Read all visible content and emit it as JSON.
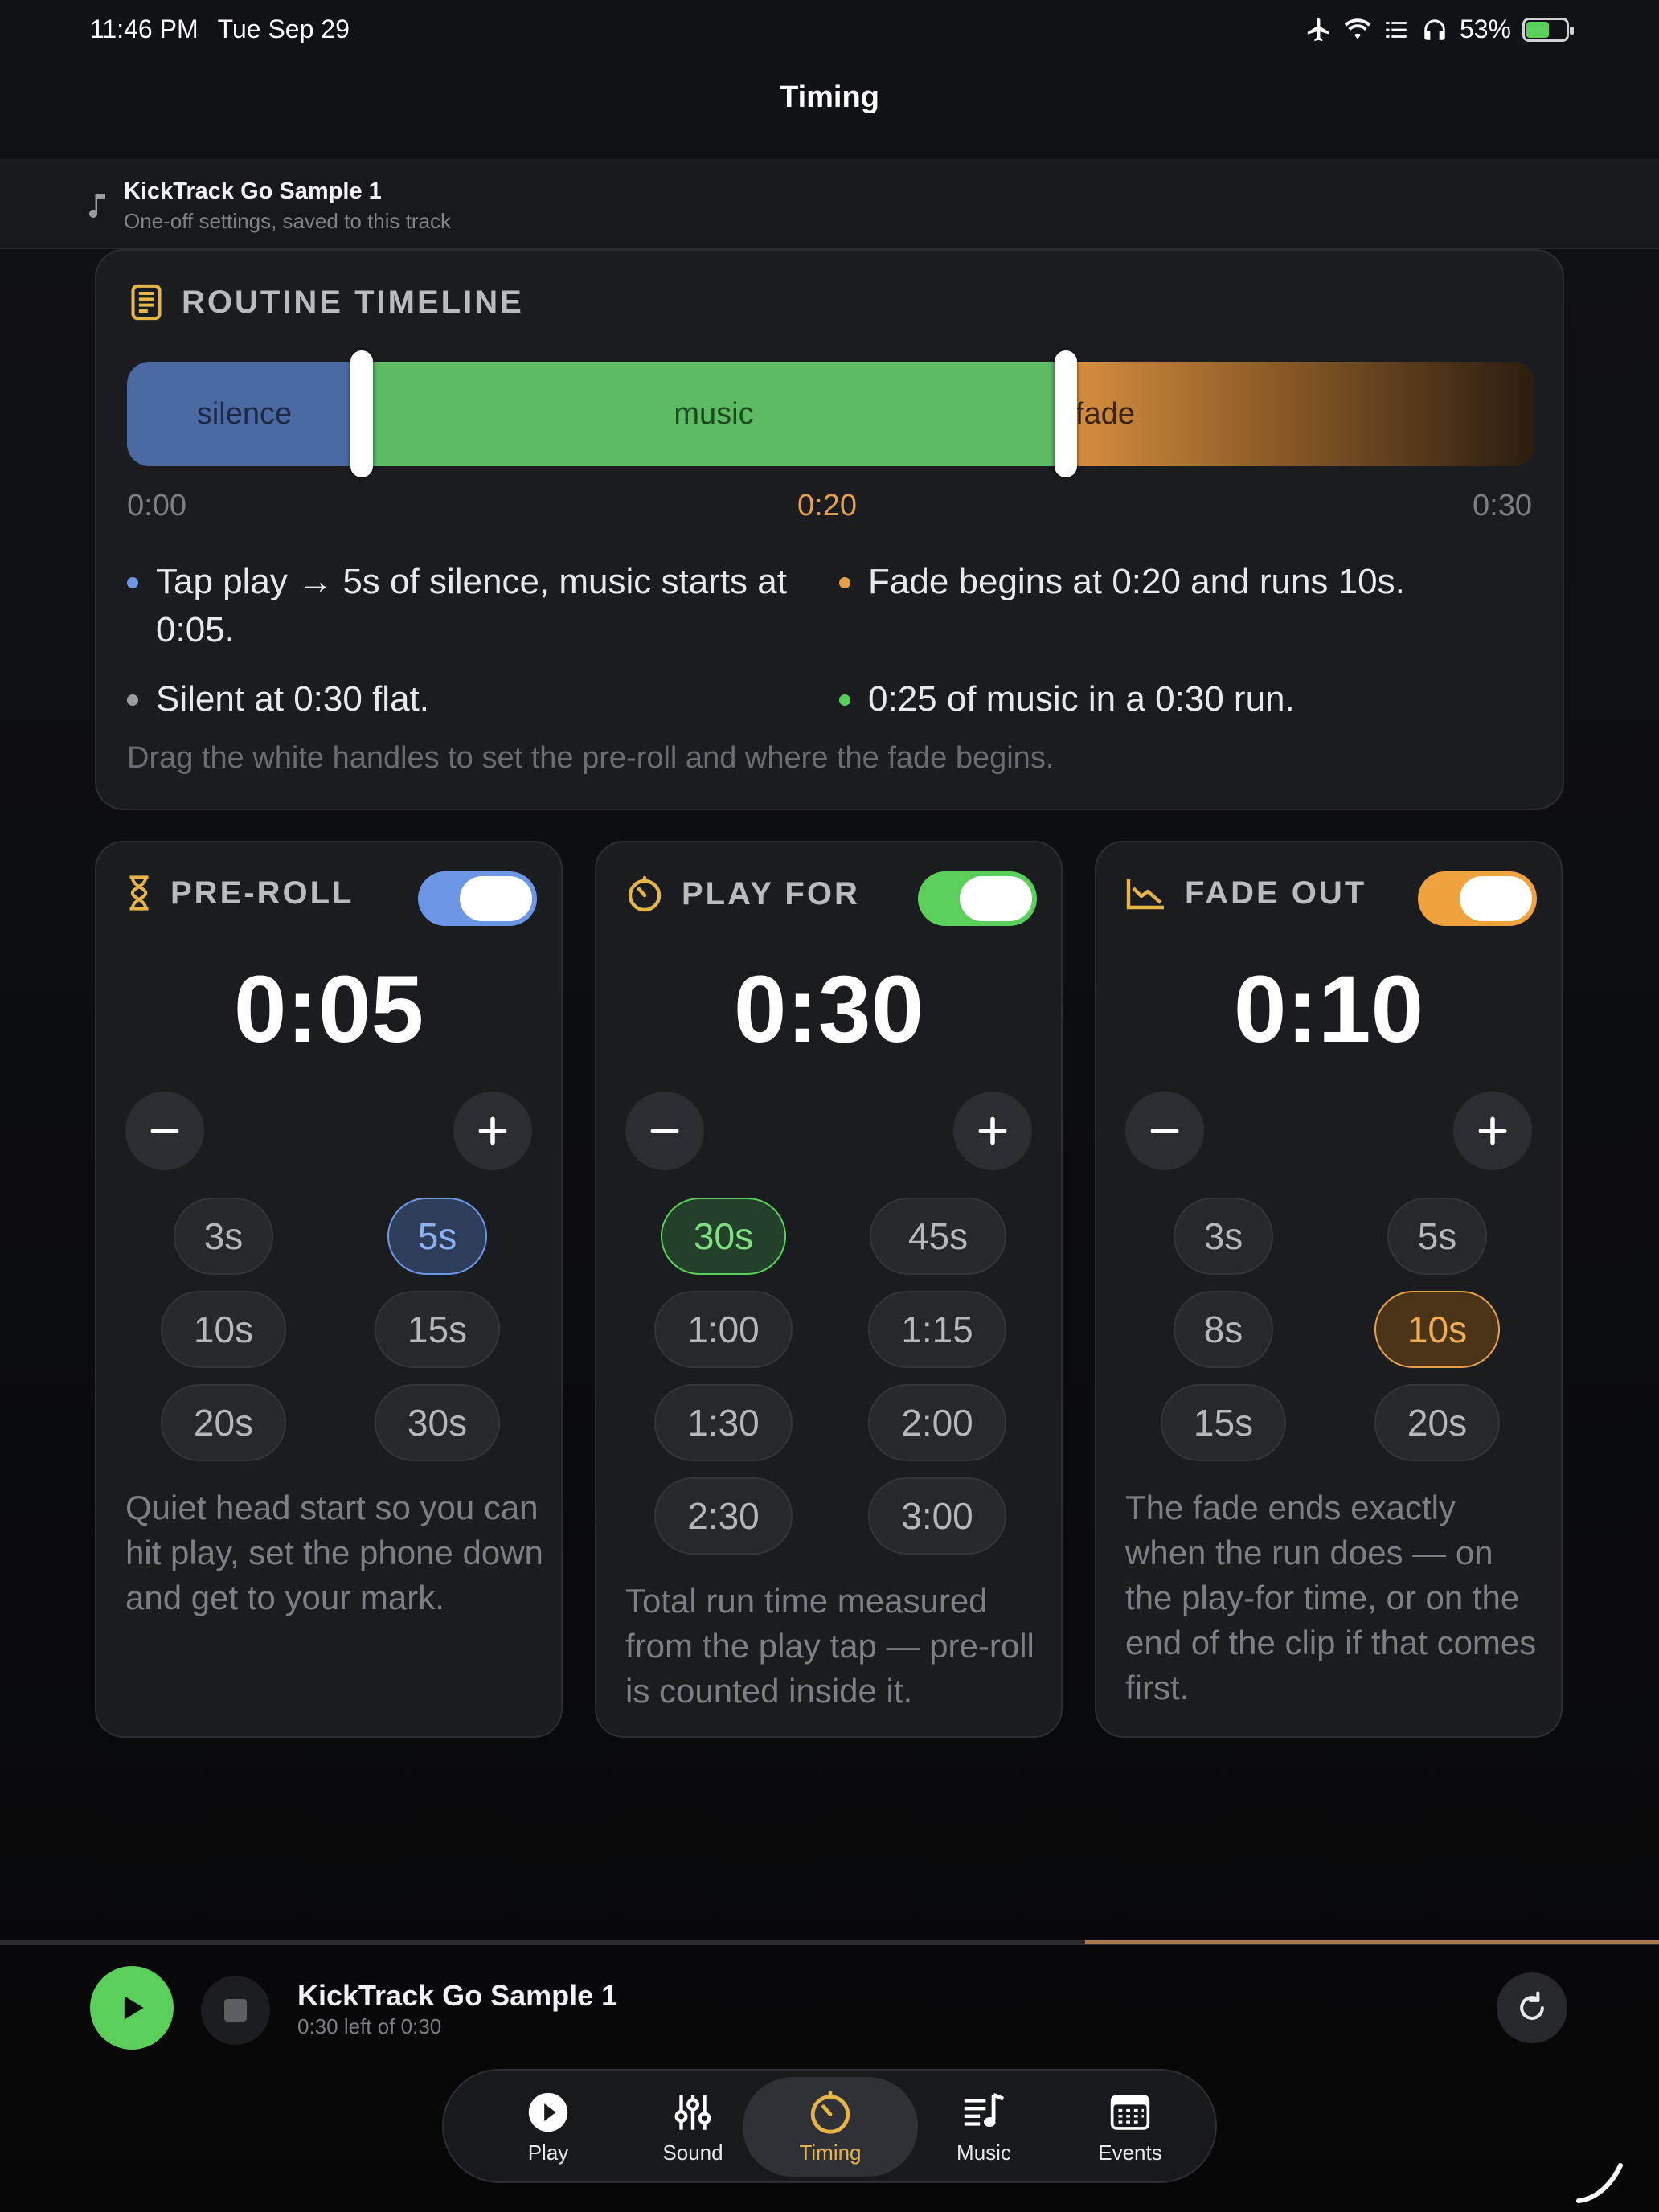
{
  "status_bar": {
    "time": "11:46 PM",
    "date": "Tue Sep 29",
    "battery": "53%"
  },
  "nav": {
    "title": "Timing"
  },
  "track": {
    "name": "KickTrack Go Sample 1",
    "subtitle": "One-off settings, saved to this track"
  },
  "timeline": {
    "title": "ROUTINE TIMELINE",
    "segments": {
      "silence": "silence",
      "music": "music",
      "fade": "fade"
    },
    "ticks": {
      "start": "0:00",
      "mid": "0:20",
      "end": "0:30"
    },
    "bullets": [
      "Tap play → 5s of silence, music starts at 0:05.",
      "Fade begins at 0:20 and runs 10s.",
      "Silent at 0:30 flat.",
      "0:25 of music in a 0:30 run."
    ],
    "hint": "Drag the white handles to set the pre-roll and where the fade begins."
  },
  "preroll": {
    "title": "PRE-ROLL",
    "value": "0:05",
    "enabled": true,
    "options": [
      "3s",
      "5s",
      "10s",
      "15s",
      "20s",
      "30s"
    ],
    "selected": "5s",
    "description": "Quiet head start so you can hit play, set the phone down and get to your mark."
  },
  "playfor": {
    "title": "PLAY FOR",
    "value": "0:30",
    "enabled": true,
    "options": [
      "30s",
      "45s",
      "1:00",
      "1:15",
      "1:30",
      "2:00",
      "2:30",
      "3:00"
    ],
    "selected": "30s",
    "description": "Total run time measured from the play tap — pre-roll is counted inside it."
  },
  "fadeout": {
    "title": "FADE OUT",
    "value": "0:10",
    "enabled": true,
    "options": [
      "3s",
      "5s",
      "8s",
      "10s",
      "15s",
      "20s"
    ],
    "selected": "10s",
    "description": "The fade ends exactly when the run does — on the play-for time, or on the end of the clip if that comes first."
  },
  "player": {
    "title": "KickTrack Go Sample 1",
    "remaining": "0:30 left of 0:30",
    "progress": 0.0
  },
  "tabs": [
    {
      "label": "Play",
      "icon": "play-circle-icon"
    },
    {
      "label": "Sound",
      "icon": "sliders-icon"
    },
    {
      "label": "Timing",
      "icon": "timer-icon",
      "active": true
    },
    {
      "label": "Music",
      "icon": "music-list-icon"
    },
    {
      "label": "Events",
      "icon": "calendar-icon"
    }
  ],
  "colors": {
    "silence": "#4b6aa3",
    "music": "#5dbb63",
    "fade": "#e6a04a",
    "accent": "#e6b548"
  }
}
